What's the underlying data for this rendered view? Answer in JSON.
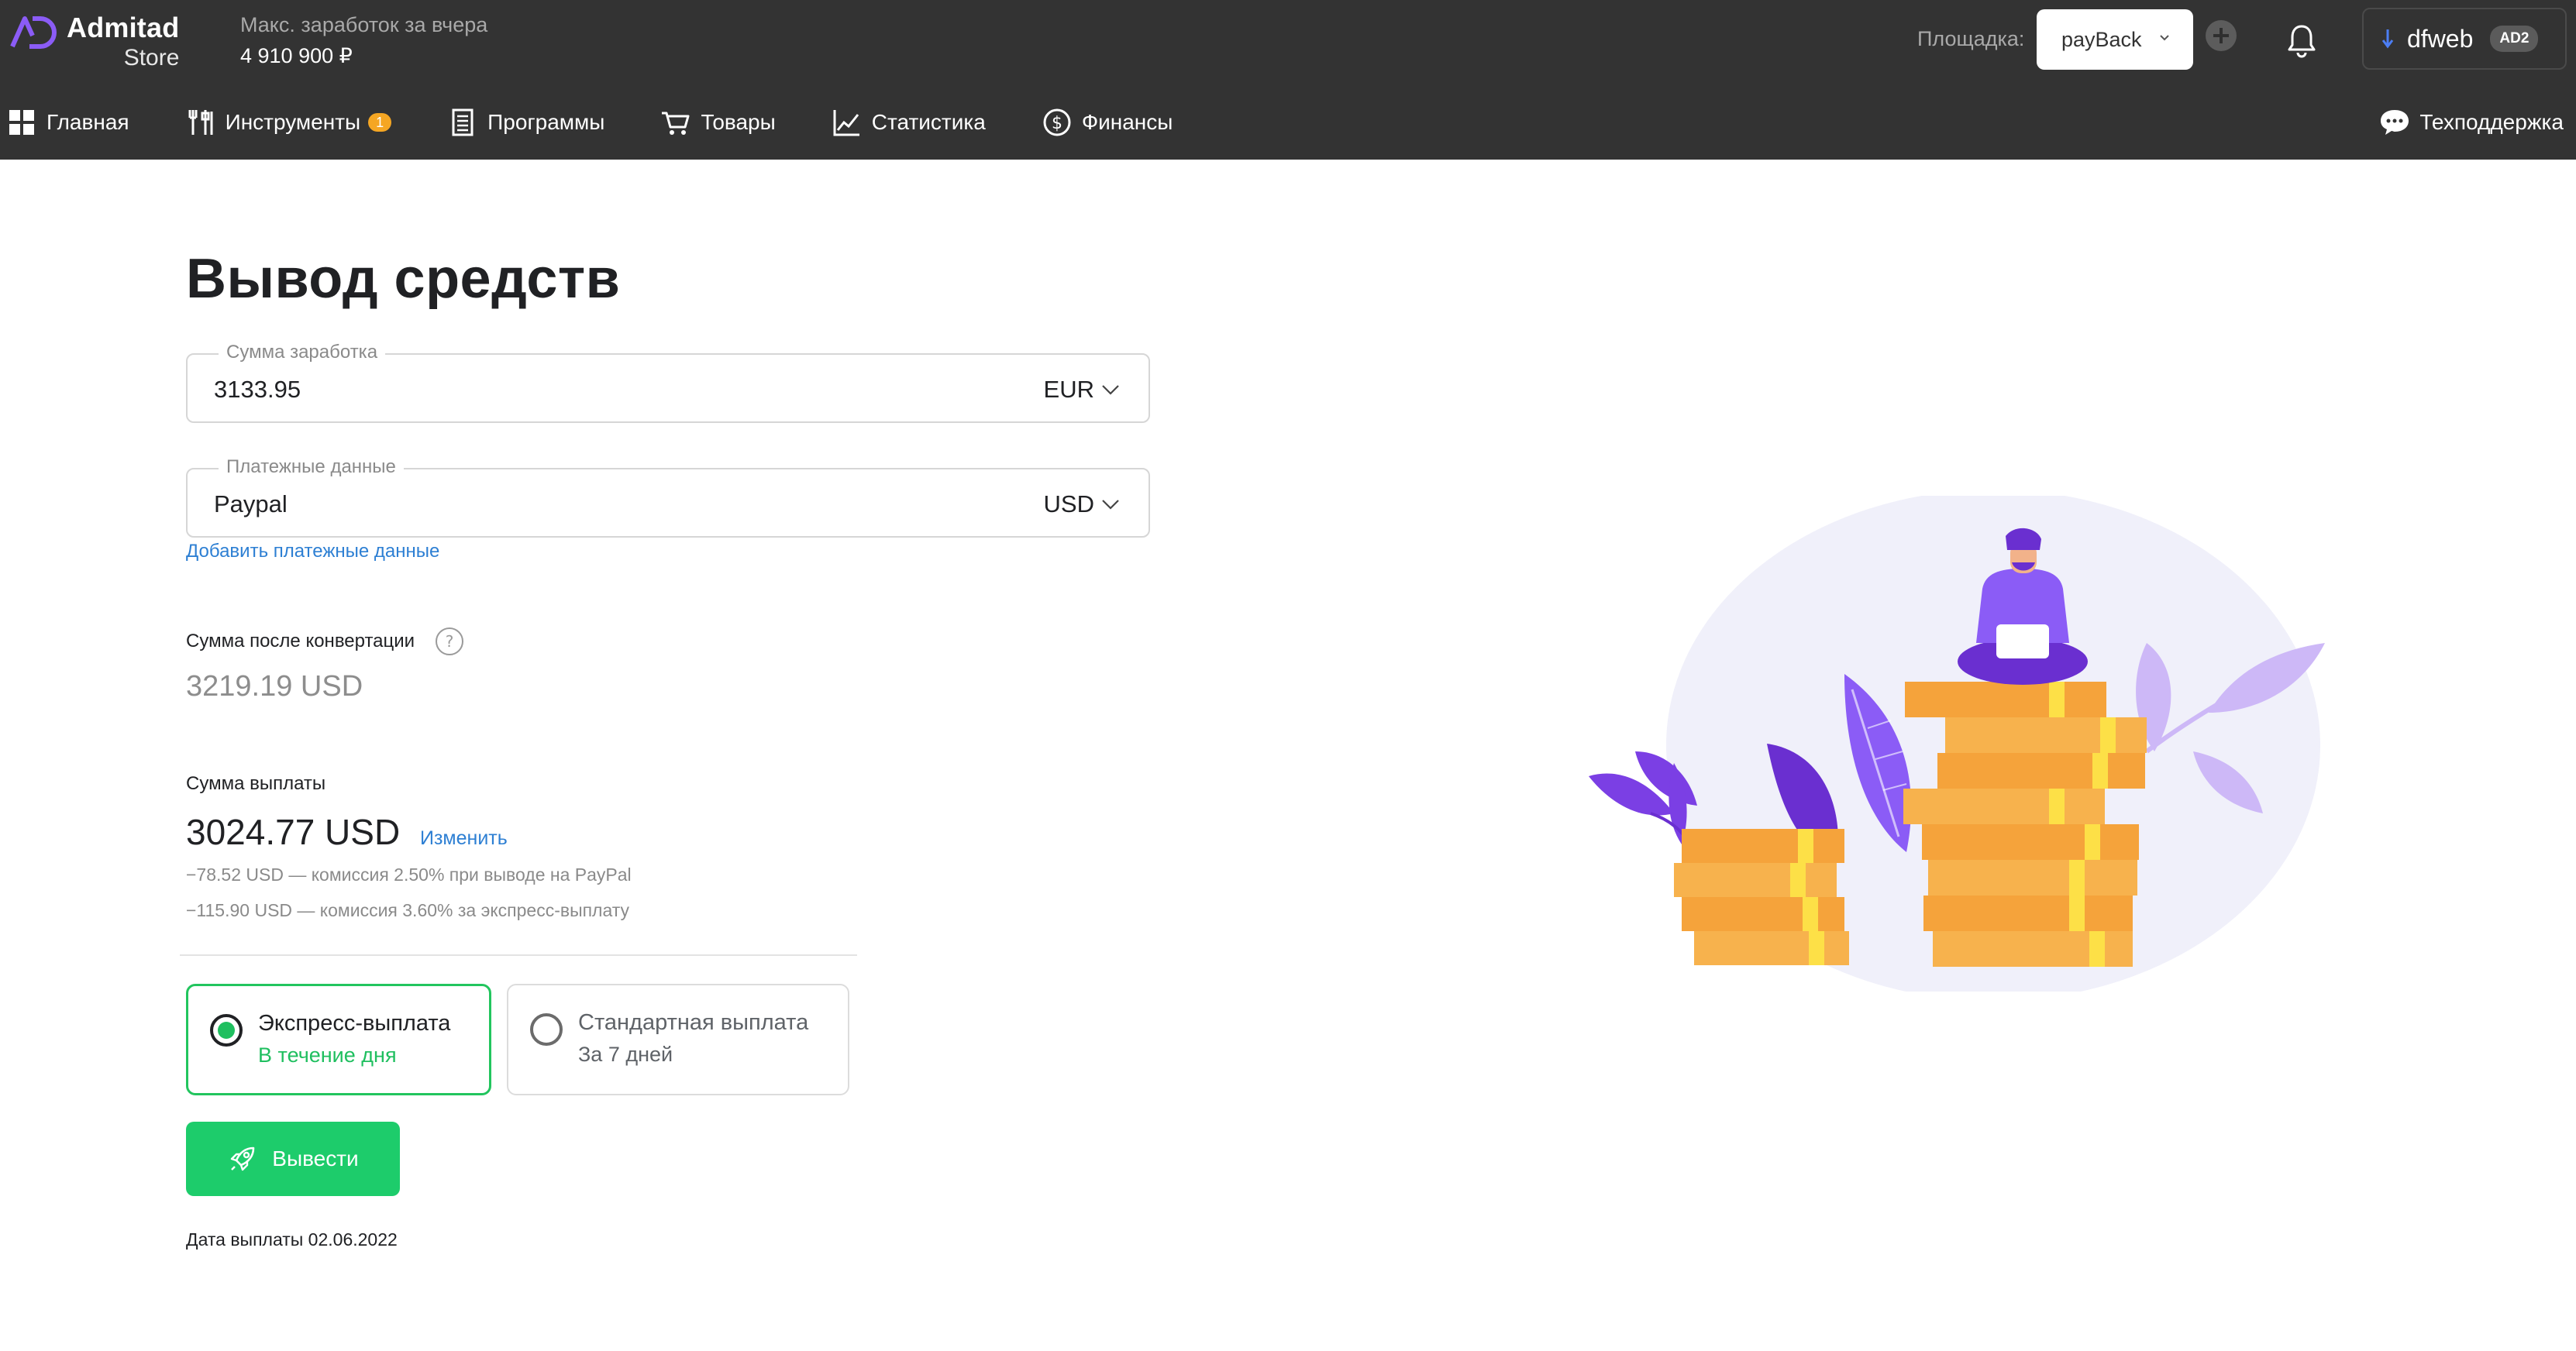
{
  "header": {
    "brand": "Admitad",
    "brand_sub": "Store",
    "earnings_label": "Макс. заработок за вчера",
    "earnings_value": "4 910 900 ₽",
    "platform_label": "Площадка:",
    "platform_value": "payBack",
    "user_name": "dfweb",
    "user_badge": "AD2"
  },
  "nav": {
    "items": [
      {
        "label": "Главная",
        "icon": "grid-icon"
      },
      {
        "label": "Инструменты",
        "icon": "tools-icon",
        "badge": "1"
      },
      {
        "label": "Программы",
        "icon": "document-icon"
      },
      {
        "label": "Товары",
        "icon": "cart-icon"
      },
      {
        "label": "Статистика",
        "icon": "chart-icon"
      },
      {
        "label": "Финансы",
        "icon": "dollar-icon"
      }
    ],
    "support": "Техподдержка"
  },
  "page": {
    "title": "Вывод средств",
    "earn_field": {
      "label": "Сумма заработка",
      "value": "3133.95",
      "currency": "EUR"
    },
    "payment_field": {
      "label": "Платежные данные",
      "value": "Paypal",
      "currency": "USD"
    },
    "add_payment_link": "Добавить платежные данные",
    "conversion_label": "Сумма после конвертации",
    "conversion_value": "3219.19 USD",
    "payout_label": "Сумма выплаты",
    "payout_value": "3024.77 USD",
    "change_link": "Изменить",
    "fees": [
      "−78.52 USD — комиссия 2.50% при выводе на PayPal",
      "−115.90 USD — комиссия 3.60% за экспресс-выплату"
    ],
    "options": [
      {
        "title": "Экспресс-выплата",
        "subtitle": "В течение дня",
        "selected": true
      },
      {
        "title": "Стандартная выплата",
        "subtitle": "За 7 дней",
        "selected": false
      }
    ],
    "withdraw_button": "Вывести",
    "payout_date": "Дата выплаты 02.06.2022"
  },
  "colors": {
    "topbar": "#333333",
    "accent_green": "#1dcc6b",
    "link_blue": "#2d7fd3",
    "brand_purple": "#7b3fe4",
    "coin_orange": "#f5a33b"
  }
}
